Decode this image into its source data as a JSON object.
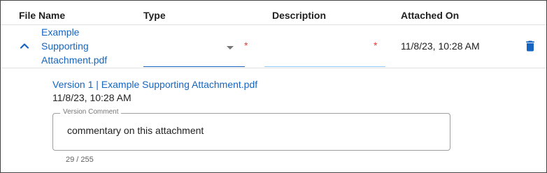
{
  "table": {
    "headers": {
      "file_name": "File Name",
      "type": "Type",
      "description": "Description",
      "attached_on": "Attached On"
    },
    "row": {
      "expand_icon": "chevron-up-icon",
      "file_name": "Example Supporting Attachment.pdf",
      "type_value": "",
      "type_required": "*",
      "description_value": "",
      "description_required": "*",
      "attached_on": "11/8/23, 10:28 AM",
      "delete_icon": "trash-icon"
    }
  },
  "version": {
    "link": "Version 1 | Example Supporting Attachment.pdf",
    "date": "11/8/23, 10:28 AM",
    "comment_label": "Version Comment",
    "comment_value": "commentary on this attachment",
    "char_count": "29 / 255"
  },
  "colors": {
    "link": "#1565c0",
    "required": "#e53935",
    "delete": "#1565c0"
  }
}
